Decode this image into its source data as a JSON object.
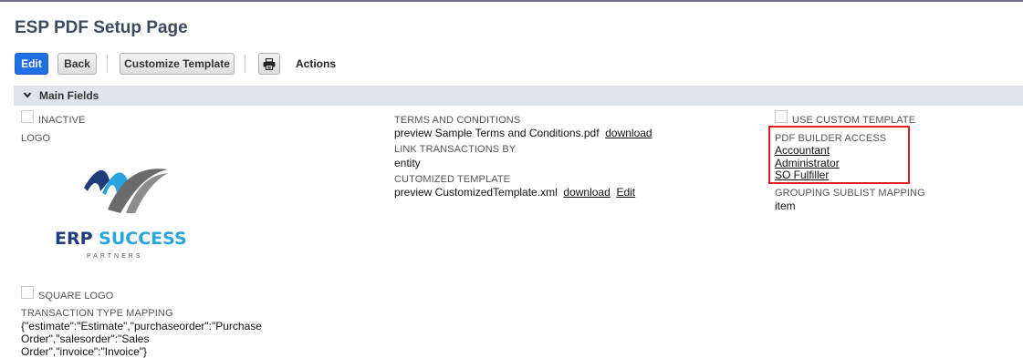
{
  "page": {
    "title": "ESP PDF Setup Page"
  },
  "toolbar": {
    "edit_label": "Edit",
    "back_label": "Back",
    "customize_label": "Customize Template",
    "actions_label": "Actions"
  },
  "section": {
    "title": "Main Fields"
  },
  "fields": {
    "inactive": {
      "label": "INACTIVE",
      "checked": false
    },
    "logo": {
      "label": "LOGO"
    },
    "logo_image": {
      "brand_text": "ERP SUCCESS",
      "sub_text": "PARTNERS"
    },
    "square_logo": {
      "label": "SQUARE LOGO",
      "checked": false
    },
    "transaction_type_mapping": {
      "label": "TRANSACTION TYPE MAPPING",
      "value_line1": "{\"estimate\":\"Estimate\",\"purchaseorder\":\"Purchase Order\",\"salesorder\":\"Sales",
      "value_line2": "Order\",\"invoice\":\"Invoice\"}"
    },
    "terms_and_conditions": {
      "label": "TERMS AND CONDITIONS",
      "value": "preview Sample Terms and Conditions.pdf",
      "download_label": "download"
    },
    "link_transactions_by": {
      "label": "LINK TRANSACTIONS BY",
      "value": "entity"
    },
    "customized_template": {
      "label": "CUTOMIZED TEMPLATE",
      "value": "preview CustomizedTemplate.xml",
      "download_label": "download",
      "edit_label": "Edit"
    },
    "use_custom_template": {
      "label": "USE CUSTOM TEMPLATE",
      "checked": false
    },
    "pdf_builder_access": {
      "label": "PDF BUILDER ACCESS",
      "roles": [
        "Accountant",
        "Administrator",
        "SO Fulfiller"
      ]
    },
    "grouping_sublist_mapping": {
      "label": "GROUPING SUBLIST MAPPING",
      "value": "item"
    }
  },
  "colors": {
    "primary_button": "#1f6fe5",
    "section_bar": "#e0e4ea",
    "highlight_border": "#e02020",
    "title": "#3d4b5e",
    "logo_navy": "#1f3d7a",
    "logo_blue": "#2aa4dc",
    "logo_gray": "#6b6b6b"
  },
  "icons": {
    "print": "printer-icon",
    "section_toggle": "chevron-down-icon"
  }
}
